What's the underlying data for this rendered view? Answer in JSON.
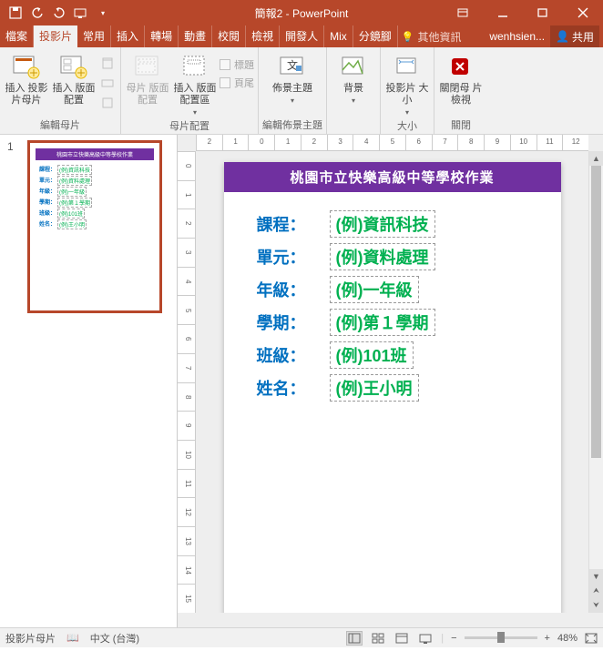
{
  "window": {
    "title": "簡報2 - PowerPoint"
  },
  "user": "wenhsien...",
  "share": "共用",
  "tell_me": "其他資訊",
  "tabs": {
    "file": "檔案",
    "slidemaster": "投影片",
    "home": "常用",
    "insert": "插入",
    "transitions": "轉場",
    "animations": "動畫",
    "review": "校閱",
    "view": "檢視",
    "developer": "開發人",
    "mix": "Mix",
    "t9": "分鏡腳"
  },
  "ribbon": {
    "edit_master": {
      "insert_slide_master": "插入\n投影片母片",
      "insert_layout": "插入\n版面配置",
      "label": "編輯母片"
    },
    "master_layout": {
      "master_layout": "母片\n版面配置",
      "insert_placeholder": "插入\n版面配置區",
      "title_chk": "標題",
      "footer_chk": "頁尾",
      "label": "母片配置"
    },
    "edit_theme": {
      "themes": "佈景主題",
      "label": "編輯佈景主題"
    },
    "background": {
      "background": "背景",
      "label": ""
    },
    "size": {
      "slide_size": "投影片\n大小",
      "label": "大小"
    },
    "close": {
      "close_master": "關閉母\n片檢視",
      "label": "關閉"
    }
  },
  "slide": {
    "number": "1",
    "header": "桃園市立快樂高級中等學校作業",
    "fields": [
      {
        "k": "課程：",
        "v": "(例)資訊科技"
      },
      {
        "k": "單元：",
        "v": "(例)資料處理"
      },
      {
        "k": "年級：",
        "v": "(例)一年級"
      },
      {
        "k": "學期：",
        "v": "(例)第１學期"
      },
      {
        "k": "班級：",
        "v": "(例)101班"
      },
      {
        "k": "姓名：",
        "v": "(例)王小明"
      }
    ]
  },
  "status": {
    "view": "投影片母片",
    "lang": "中文 (台灣)",
    "zoom": "48%"
  },
  "ruler_h": [
    "2",
    "1",
    "0",
    "1",
    "2",
    "3",
    "4",
    "5",
    "6",
    "7",
    "8",
    "9",
    "10",
    "11",
    "12"
  ],
  "ruler_v": [
    "0",
    "1",
    "2",
    "3",
    "4",
    "5",
    "6",
    "7",
    "8",
    "9",
    "10",
    "11",
    "12",
    "13",
    "14",
    "15"
  ]
}
